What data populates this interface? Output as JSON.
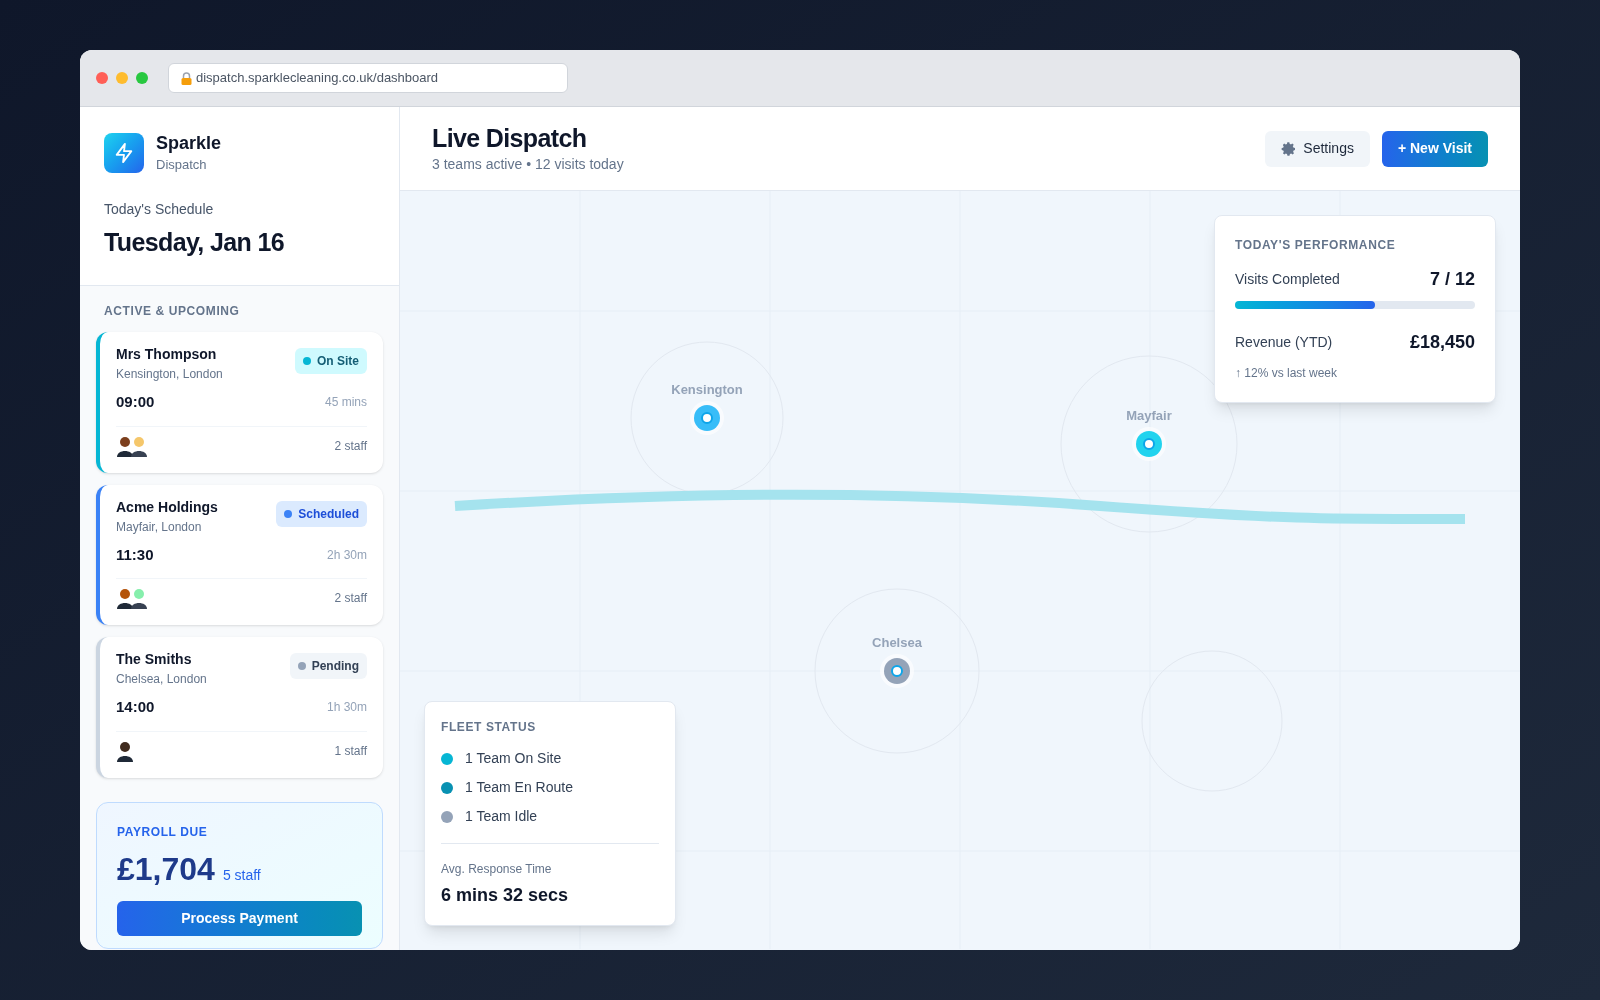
{
  "browser": {
    "url": "dispatch.sparklecleaning.co.uk/dashboard"
  },
  "sidebar": {
    "brand": {
      "name": "Sparkle",
      "subtitle": "Dispatch"
    },
    "schedule_label": "Today's Schedule",
    "date": "Tuesday, Jan 16",
    "section_title": "ACTIVE & UPCOMING",
    "visits": [
      {
        "client": "Mrs Thompson",
        "location": "Kensington, London",
        "status": "On Site",
        "kind": "on_site",
        "time": "09:00",
        "duration": "45 mins",
        "avatars": [
          {
            "color": "#7c3f1d"
          },
          {
            "color": "#f5c76b"
          }
        ],
        "staff": "2 staff"
      },
      {
        "client": "Acme Holdings",
        "location": "Mayfair, London",
        "status": "Scheduled",
        "kind": "scheduled",
        "time": "11:30",
        "duration": "2h 30m",
        "avatars": [
          {
            "color": "#b45309"
          },
          {
            "color": "#86efac"
          }
        ],
        "staff": "2 staff"
      },
      {
        "client": "The Smiths",
        "location": "Chelsea, London",
        "status": "Pending",
        "kind": "pending",
        "time": "14:00",
        "duration": "1h 30m",
        "avatars": [
          {
            "color": "#3f2a1d"
          }
        ],
        "staff": "1 staff"
      }
    ],
    "payroll": {
      "title": "PAYROLL DUE",
      "amount": "£1,704",
      "staff": "5 staff",
      "button": "Process Payment"
    }
  },
  "header": {
    "title": "Live Dispatch",
    "subtitle": "3 teams active • 12 visits today",
    "buttons": [
      {
        "label": "Settings",
        "kind": "secondary"
      },
      {
        "label": "+ New Visit",
        "kind": "primary"
      }
    ]
  },
  "map": {
    "pins": [
      {
        "label": "Kensington",
        "color": "#38bdf8"
      },
      {
        "label": "Mayfair",
        "color": "#22d3ee"
      },
      {
        "label": "Chelsea",
        "color": "#94a3b8"
      }
    ]
  },
  "performance": {
    "title": "TODAY'S PERFORMANCE",
    "visits_label": "Visits Completed",
    "visits_value": "7 / 12",
    "level": 0.583,
    "revenue_label": "Revenue (YTD)",
    "revenue_value": "£18,450",
    "trend": "↑ 12% vs last week"
  },
  "fleet": {
    "title": "FLEET STATUS",
    "items": [
      {
        "label": "1 Team On Site",
        "color": "#06b6d4"
      },
      {
        "label": "1 Team En Route",
        "color": "#0891b2"
      },
      {
        "label": "1 Team Idle",
        "color": "#94a3b8"
      }
    ],
    "response_label": "Avg. Response Time",
    "response_value": "6 mins 32 secs"
  }
}
